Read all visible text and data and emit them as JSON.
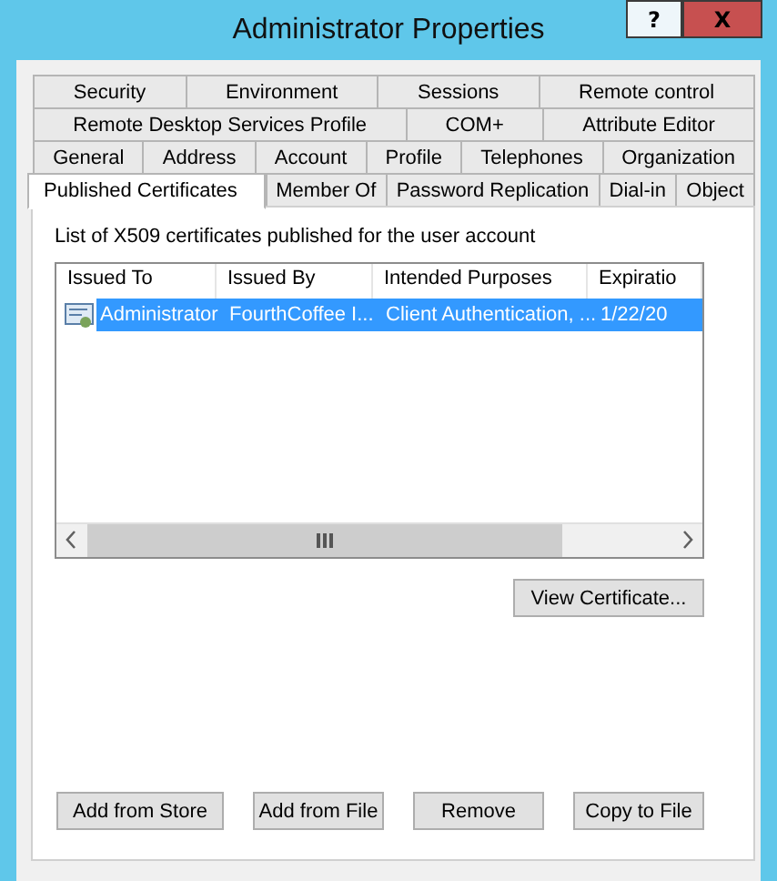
{
  "window": {
    "title": "Administrator Properties",
    "help_button": "?",
    "close_button": "X"
  },
  "tab_rows": [
    [
      {
        "label": "Security",
        "selected": false
      },
      {
        "label": "Environment",
        "selected": false
      },
      {
        "label": "Sessions",
        "selected": false
      },
      {
        "label": "Remote control",
        "selected": false
      }
    ],
    [
      {
        "label": "Remote Desktop Services Profile",
        "selected": false
      },
      {
        "label": "COM+",
        "selected": false
      },
      {
        "label": "Attribute Editor",
        "selected": false
      }
    ],
    [
      {
        "label": "General",
        "selected": false
      },
      {
        "label": "Address",
        "selected": false
      },
      {
        "label": "Account",
        "selected": false
      },
      {
        "label": "Profile",
        "selected": false
      },
      {
        "label": "Telephones",
        "selected": false
      },
      {
        "label": "Organization",
        "selected": false
      }
    ],
    [
      {
        "label": "Published Certificates",
        "selected": true
      },
      {
        "label": "Member Of",
        "selected": false
      },
      {
        "label": "Password Replication",
        "selected": false
      },
      {
        "label": "Dial-in",
        "selected": false
      },
      {
        "label": "Object",
        "selected": false
      }
    ]
  ],
  "description": "List of X509 certificates published for the user account",
  "list": {
    "columns": [
      "Issued To",
      "Issued By",
      "Intended Purposes",
      "Expiratio"
    ],
    "rows": [
      {
        "cells": [
          "Administrator",
          "FourthCoffee I...",
          "Client Authentication, ...",
          "1/22/20"
        ],
        "selected": true
      }
    ]
  },
  "view_button": "View Certificate...",
  "buttons": [
    "Add from Store",
    "Add from File",
    "Remove",
    "Copy to File"
  ]
}
